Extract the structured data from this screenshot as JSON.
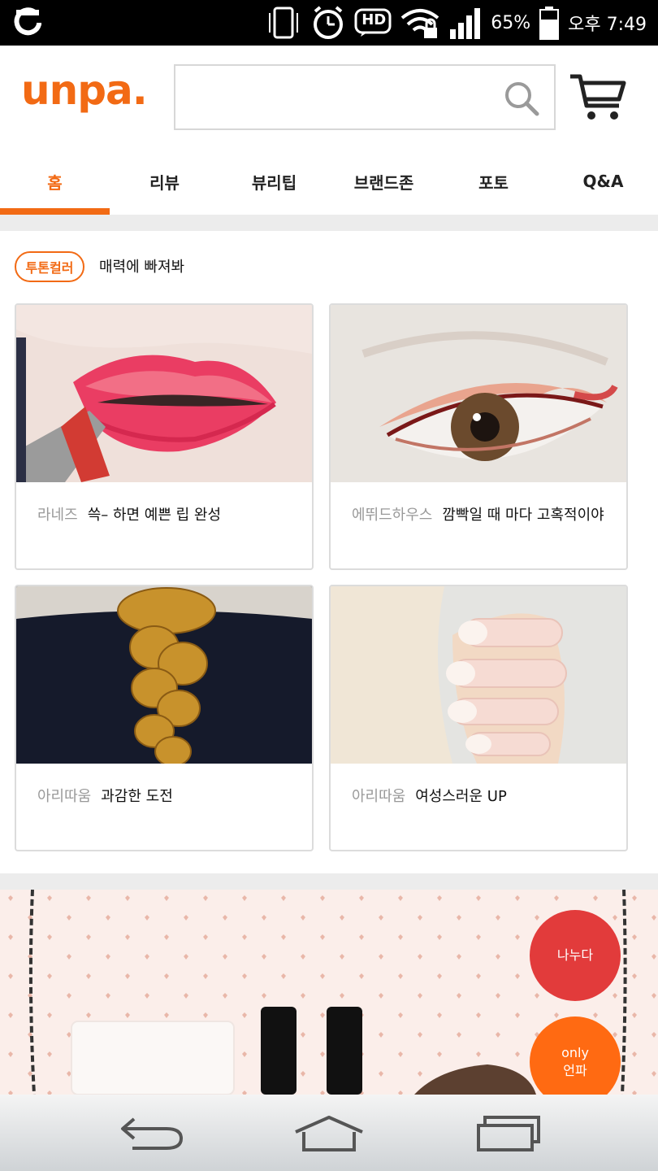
{
  "status_bar": {
    "hd_label": "HD",
    "battery": "65%",
    "time": "오후 7:49",
    "icons": [
      "carrier-logo-icon",
      "vibrate-icon",
      "alarm-icon",
      "hd-icon",
      "wifi-lock-icon",
      "signal-icon",
      "battery-icon"
    ]
  },
  "header": {
    "logo": "unpa.",
    "search": {
      "value": "",
      "placeholder": ""
    },
    "icons": [
      "search-icon",
      "cart-icon"
    ]
  },
  "tabs": [
    {
      "label": "홈",
      "active": true
    },
    {
      "label": "리뷰",
      "active": false
    },
    {
      "label": "뷰리팁",
      "active": false
    },
    {
      "label": "브랜드존",
      "active": false
    },
    {
      "label": "포토",
      "active": false
    },
    {
      "label": "Q&A",
      "active": false
    }
  ],
  "section": {
    "tag": "투톤컬러",
    "title": "매력에 빠져봐"
  },
  "cards": [
    {
      "brand": "라네즈",
      "title": "쓱– 하면 예쁜 립 완성",
      "image": "lip-photo"
    },
    {
      "brand": "에뛰드하우스",
      "title": "깜빡일 때 마다 고혹적이야",
      "image": "eye-photo"
    },
    {
      "brand": "아리따움",
      "title": "과감한 도전",
      "image": "hair-photo"
    },
    {
      "brand": "아리따움",
      "title": "여성스러운 UP",
      "image": "nail-photo"
    }
  ],
  "floating": {
    "share": "나누다",
    "only_line1": "only",
    "only_line2": "언파"
  },
  "nav": {
    "icons": [
      "back-icon",
      "home-icon",
      "recents-icon"
    ]
  },
  "colors": {
    "accent": "#f26a14",
    "share_button": "#e23b3b",
    "only_button": "#ff6a12"
  }
}
